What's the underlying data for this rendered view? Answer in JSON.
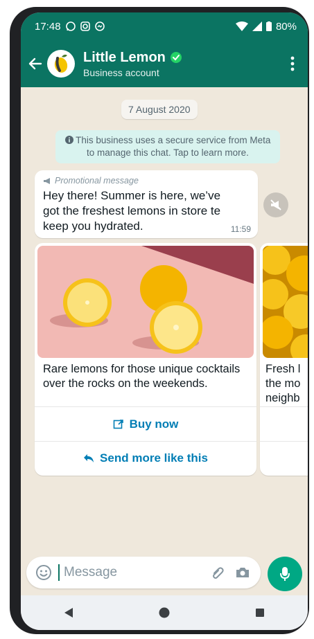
{
  "status": {
    "time": "17:48",
    "battery": "80%"
  },
  "header": {
    "title": "Little Lemon",
    "subtitle": "Business account"
  },
  "chat": {
    "date": "7 August 2020",
    "notice": "This business uses a secure service from Meta to manage this chat. Tap to learn more.",
    "message": {
      "label": "Promotional message",
      "text": "Hey there! Summer is here, we’ve got the freshest lemons in store te keep you hydrated.",
      "time": "11:59"
    },
    "cards": [
      {
        "text": "Rare lemons for those unique cocktails over the rocks on the weekends.",
        "actions": [
          {
            "label": "Buy now",
            "icon": "external-link-icon"
          },
          {
            "label": "Send more like this",
            "icon": "reply-icon"
          }
        ]
      },
      {
        "text_lines": [
          "Fresh l",
          "the mo",
          "neighb"
        ]
      }
    ]
  },
  "input": {
    "placeholder": "Message"
  },
  "colors": {
    "header": "#0b7462",
    "accent": "#00a884",
    "link": "#027eb5",
    "notice_bg": "#d9f3ef",
    "chat_bg": "#efe8dc"
  }
}
